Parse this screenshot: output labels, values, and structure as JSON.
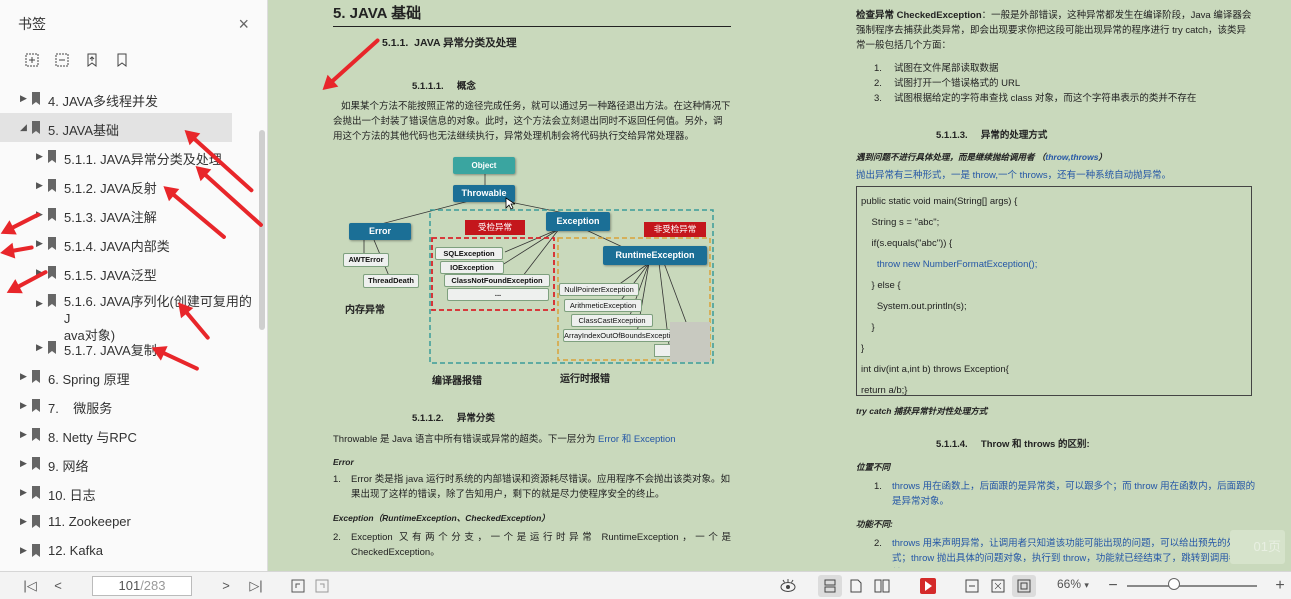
{
  "sidebar": {
    "title": "书签",
    "close_icon": "×",
    "tools": [
      "add-bookmark-icon",
      "remove-bookmark-icon",
      "bookmark-up-icon",
      "bookmark-icon"
    ],
    "items": [
      {
        "label": "4. JAVA多线程并发",
        "level": 0,
        "expanded": false
      },
      {
        "label": "5. JAVA基础",
        "level": 0,
        "expanded": true,
        "selected": true
      },
      {
        "label": "5.1.1. JAVA异常分类及处理",
        "level": 1,
        "expanded": false
      },
      {
        "label": "5.1.2. JAVA反射",
        "level": 1,
        "expanded": false
      },
      {
        "label": "5.1.3. JAVA注解",
        "level": 1,
        "expanded": false
      },
      {
        "label": "5.1.4. JAVA内部类",
        "level": 1,
        "expanded": false
      },
      {
        "label": "5.1.5. JAVA泛型",
        "level": 1,
        "expanded": false
      },
      {
        "label": "5.1.6. JAVA序列化(创建可复用的J",
        "label2": "ava对象)",
        "level": 1,
        "expanded": false
      },
      {
        "label": "5.1.7. JAVA复制",
        "level": 1,
        "expanded": false
      },
      {
        "label": "6. Spring 原理",
        "level": 0,
        "expanded": false
      },
      {
        "label": "7.    微服务",
        "level": 0,
        "expanded": false
      },
      {
        "label": "8. Netty 与RPC",
        "level": 0,
        "expanded": false
      },
      {
        "label": "9. 网络",
        "level": 0,
        "expanded": false
      },
      {
        "label": "10. 日志",
        "level": 0,
        "expanded": false
      },
      {
        "label": "11. Zookeeper",
        "level": 0,
        "expanded": false
      },
      {
        "label": "12. Kafka",
        "level": 0,
        "expanded": false
      }
    ]
  },
  "left_page": {
    "h1": "5. JAVA 基础",
    "h2": "5.1.1.  JAVA 异常分类及处理",
    "h3_concept": "5.1.1.1.     概念",
    "concept_text": "如果某个方法不能按照正常的途径完成任务，就可以通过另一种路径退出方法。在这种情况下会抛出一个封装了错误信息的对象。此时，这个方法会立刻退出同时不返回任何值。另外，调用这个方法的其他代码也无法继续执行，异常处理机制会将代码执行交给异常处理器。",
    "diagram": {
      "object": "Object",
      "throwable": "Throwable",
      "error": "Error",
      "exception": "Exception",
      "awterror": "AWTError",
      "threaddeath": "ThreadDeath",
      "checked_label": "受检异常",
      "unchecked_label": "非受检异常",
      "checked": [
        "SQLException",
        "IOException",
        "ClassNotFoundException",
        "..."
      ],
      "runtime": "RuntimeException",
      "runtime_children": [
        "NullPointerException",
        "ArithmeticException",
        "ClassCastException",
        "ArrayIndexOutOfBoundsException"
      ],
      "label_memory": "内存异常",
      "label_compile": "编译器报错",
      "label_runtime": "运行时报错"
    },
    "h3_category": "5.1.1.2.     异常分类",
    "category_text_a": "Throwable 是 Java 语言中所有错误或异常的超类。下一层分为 ",
    "category_text_b": "Error 和 Exception",
    "error_heading": "Error",
    "error_item": "Error 类是指 java 运行时系统的内部错误和资源耗尽错误。应用程序不会抛出该类对象。如果出现了这样的错误，除了告知用户，剩下的就是尽力使程序安全的终止。",
    "exception_heading": "Exception（RuntimeException、CheckedException）",
    "exception_item": "Exception 又有两个分支，一个是运行时异常 RuntimeException，一个是 CheckedException。"
  },
  "right_page": {
    "checked_text_a": "检查异常 CheckedException",
    "checked_text_b": "：一般是外部错误，这种异常都发生在编译阶段，Java 编译器会强制程序去捕获此类异常，即会出现要求你把这段可能出现异常的程序进行 try catch，该类异常一般包括几个方面：",
    "checked_list": [
      "试图在文件尾部读取数据",
      "试图打开一个错误格式的 URL",
      "试图根据给定的字符串查找 class 对象，而这个字符串表示的类并不存在"
    ],
    "h3_handle": "5.1.1.3.     异常的处理方式",
    "throw_heading": "遇到问题不进行具体处理，而是继续抛给调用者 （",
    "throw_heading_b": "throw,throws",
    "throw_heading_c": "）",
    "throw_text_a": "抛出异常有三种形式，一是 throw,一个 throws，还有一种系统自动抛异常。",
    "code": [
      "public static void main(String[] args) {",
      "    String s = \"abc\";",
      "    if(s.equals(\"abc\")) {",
      "      throw new NumberFormatException();",
      "    } else {",
      "      System.out.println(s);",
      "    }",
      "}",
      "int div(int a,int b) throws Exception{",
      "return a/b;}"
    ],
    "try_catch_text": "try catch 捕获异常针对性处理方式",
    "h3_diff": "5.1.1.4.     Throw 和 throws 的区别:",
    "pos_heading": "位置不同",
    "pos_item_a": "throws 用在函数上，后面跟的是异常类，可以跟多个；而 throw 用在函数内，后面跟的是异常对象。",
    "func_heading": "功能不同:",
    "func_item_a": "throws 用来声明异常，让调用者只知道该功能可能出现的问题，可以给出预先的处理方式；throw 抛出具体的问题对象，执行到 throw，功能就已经结束了，跳转到调用者，并",
    "watermark": "01页"
  },
  "bottombar": {
    "current_page": "101",
    "total_pages": "/283",
    "zoom": "66%",
    "zoom_arrow": "▾"
  },
  "colors": {
    "page_bg": "#c9d9bc",
    "node_blue": "#1b6f96",
    "red_dash": "#d9232a",
    "teal_dash": "#3a9c9a",
    "orange_dash": "#d9a23a"
  }
}
